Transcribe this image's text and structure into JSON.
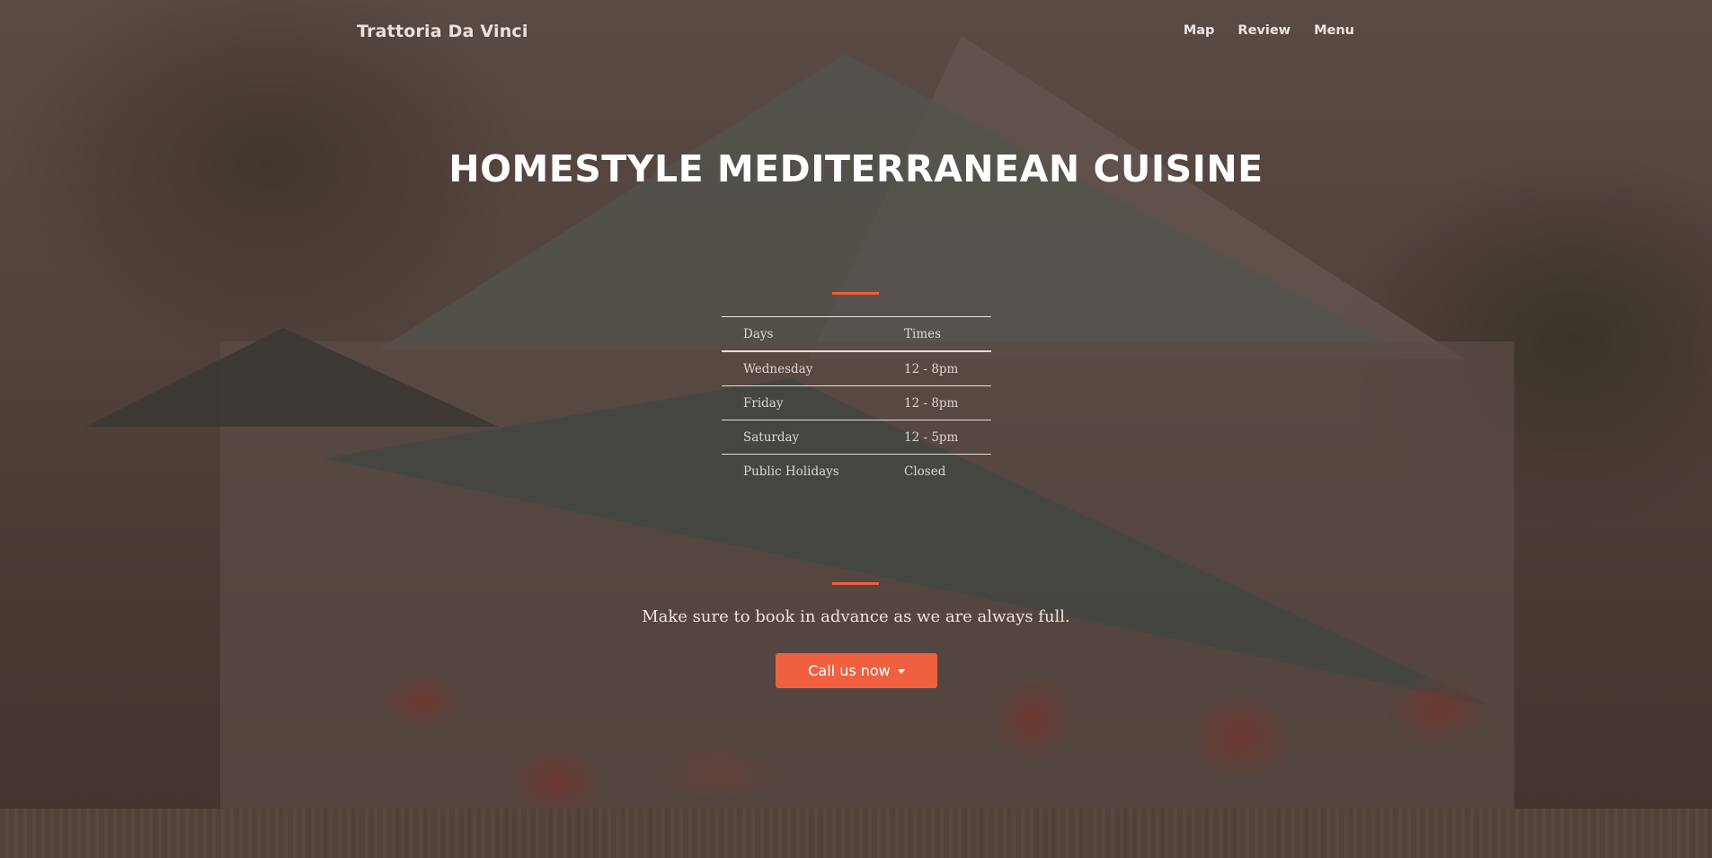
{
  "navbar": {
    "brand": "Trattoria Da Vinci",
    "links": [
      "Map",
      "Review",
      "Menu"
    ]
  },
  "hero": {
    "title": "HOMESTYLE MEDITERRANEAN CUISINE",
    "tagline": "Make sure to book in advance as we are always full.",
    "cta_label": "Call us now",
    "cta_icon": "caret-down-icon",
    "accent_color": "#f05f40"
  },
  "hours": {
    "headers": [
      "Days",
      "Times"
    ],
    "rows": [
      [
        "Wednesday",
        "12 - 8pm"
      ],
      [
        "Friday",
        "12 - 8pm"
      ],
      [
        "Saturday",
        "12 - 5pm"
      ],
      [
        "Public Holidays",
        "Closed"
      ]
    ]
  }
}
